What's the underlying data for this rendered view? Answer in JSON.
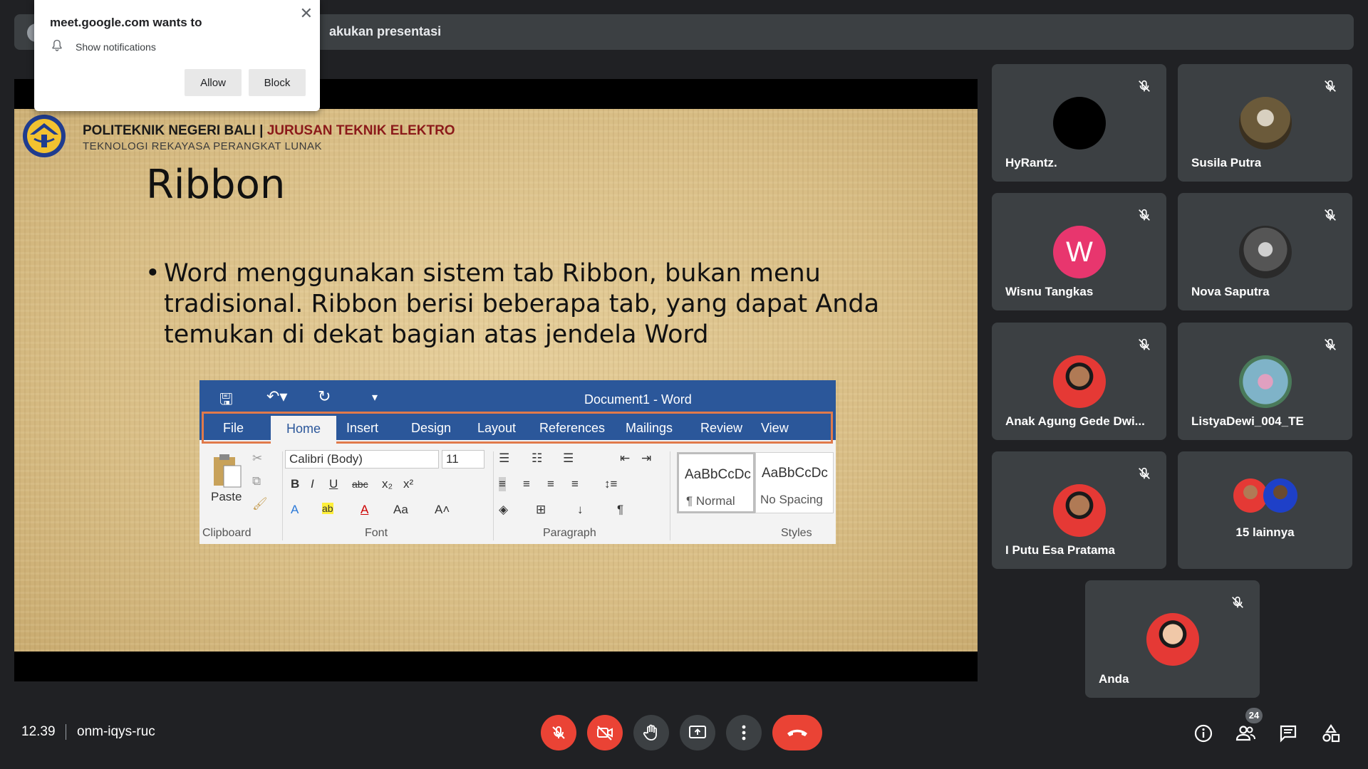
{
  "banner": {
    "text": "akukan presentasi"
  },
  "notification": {
    "title": "meet.google.com wants to",
    "subtitle": "Show notifications",
    "allow_label": "Allow",
    "block_label": "Block"
  },
  "slide": {
    "institution": "POLITEKNIK NEGERI BALI",
    "separator": "|",
    "department": "JURUSAN TEKNIK ELEKTRO",
    "program": "TEKNOLOGI REKAYASA PERANGKAT LUNAK",
    "title": "Ribbon",
    "bullet": "Word menggunakan sistem tab Ribbon, bukan menu tradisional. Ribbon berisi beberapa tab, yang dapat Anda temukan di dekat bagian atas jendela Word",
    "word": {
      "doc_title": "Document1 - Word",
      "tabs": [
        "File",
        "Home",
        "Insert",
        "Design",
        "Layout",
        "References",
        "Mailings",
        "Review",
        "View"
      ],
      "font_name": "Calibri (Body)",
      "font_size": "11",
      "paste": "Paste",
      "style1_sample": "AaBbCcDc",
      "style1_name": "¶ Normal",
      "style2_sample": "AaBbCcDc",
      "style2_name": "No Spacing",
      "groups": [
        "Clipboard",
        "Font",
        "Paragraph",
        "Styles"
      ]
    }
  },
  "participants": [
    {
      "name": "HyRantz.",
      "muted": true
    },
    {
      "name": "Susila Putra",
      "muted": true
    },
    {
      "name": "Wisnu Tangkas",
      "muted": true,
      "initial": "W"
    },
    {
      "name": "Nova Saputra",
      "muted": true
    },
    {
      "name": "Anak Agung Gede Dwi...",
      "muted": true
    },
    {
      "name": "ListyaDewi_004_TE",
      "muted": true
    },
    {
      "name": "I Putu Esa Pratama",
      "muted": true
    },
    {
      "name": "15 lainnya"
    },
    {
      "name": "Anda",
      "muted": true
    }
  ],
  "bottom": {
    "time": "12.39",
    "meeting_code": "onm-iqys-ruc",
    "people_count": "24"
  },
  "colors": {
    "danger": "#ea4335",
    "tile": "#3c4043",
    "background": "#202124",
    "word_blue": "#2b579a"
  }
}
